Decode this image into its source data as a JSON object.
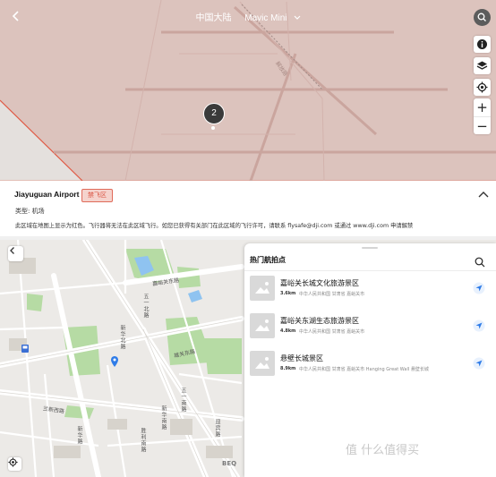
{
  "top": {
    "header": {
      "region": "中国大陆",
      "drone": "Mavic Mini",
      "back_icon": "chevron-left-icon",
      "search_icon": "search-icon"
    },
    "map": {
      "street_label": "解放路",
      "cluster_count": "2",
      "zone_color": "#dcc3bd",
      "boundary_color": "#e05a45"
    },
    "controls": [
      {
        "name": "info-icon"
      },
      {
        "name": "layers-icon"
      },
      {
        "name": "locate-icon"
      }
    ],
    "zoom": {
      "in": "+",
      "out": "−"
    },
    "info": {
      "airport_name": "Jiayuguan Airport",
      "zone_badge": "禁飞区",
      "type_label": "类型:",
      "type_value": "机场",
      "description": "此区域在地图上显示为红色。飞行器将无法在此区域飞行。如您已获得有关部门在此区域的飞行许可，请联系 flysafe@dji.com 或通过 www.dji.com 申请解禁",
      "collapse_icon": "chevron-up-icon"
    }
  },
  "bottom": {
    "map_labels": {
      "road1": "嘉峪关东路",
      "road2": "五一北路",
      "road3": "新华北路",
      "road4": "雄关东路",
      "road5": "五一南路",
      "road6": "新华南路",
      "road7": "兰新西路",
      "road8": "新华路",
      "road9": "胜利南路",
      "road10": "迎宾路",
      "baidu": "BEQ"
    },
    "sheet": {
      "title": "热门航拍点",
      "items": [
        {
          "name": "嘉峪关长城文化旅游景区",
          "distance": "3.6km",
          "address": "中华人民共和国 甘肃省 嘉峪关市"
        },
        {
          "name": "嘉峪关东湖生态旅游景区",
          "distance": "4.8km",
          "address": "中华人民共和国 甘肃省 嘉峪关市"
        },
        {
          "name": "悬壁长城景区",
          "distance": "8.9km",
          "address": "中华人民共和国 甘肃省 嘉峪关市 Hanging Great Wall 悬壁长城"
        }
      ]
    },
    "watermark": "值 什么值得买"
  }
}
